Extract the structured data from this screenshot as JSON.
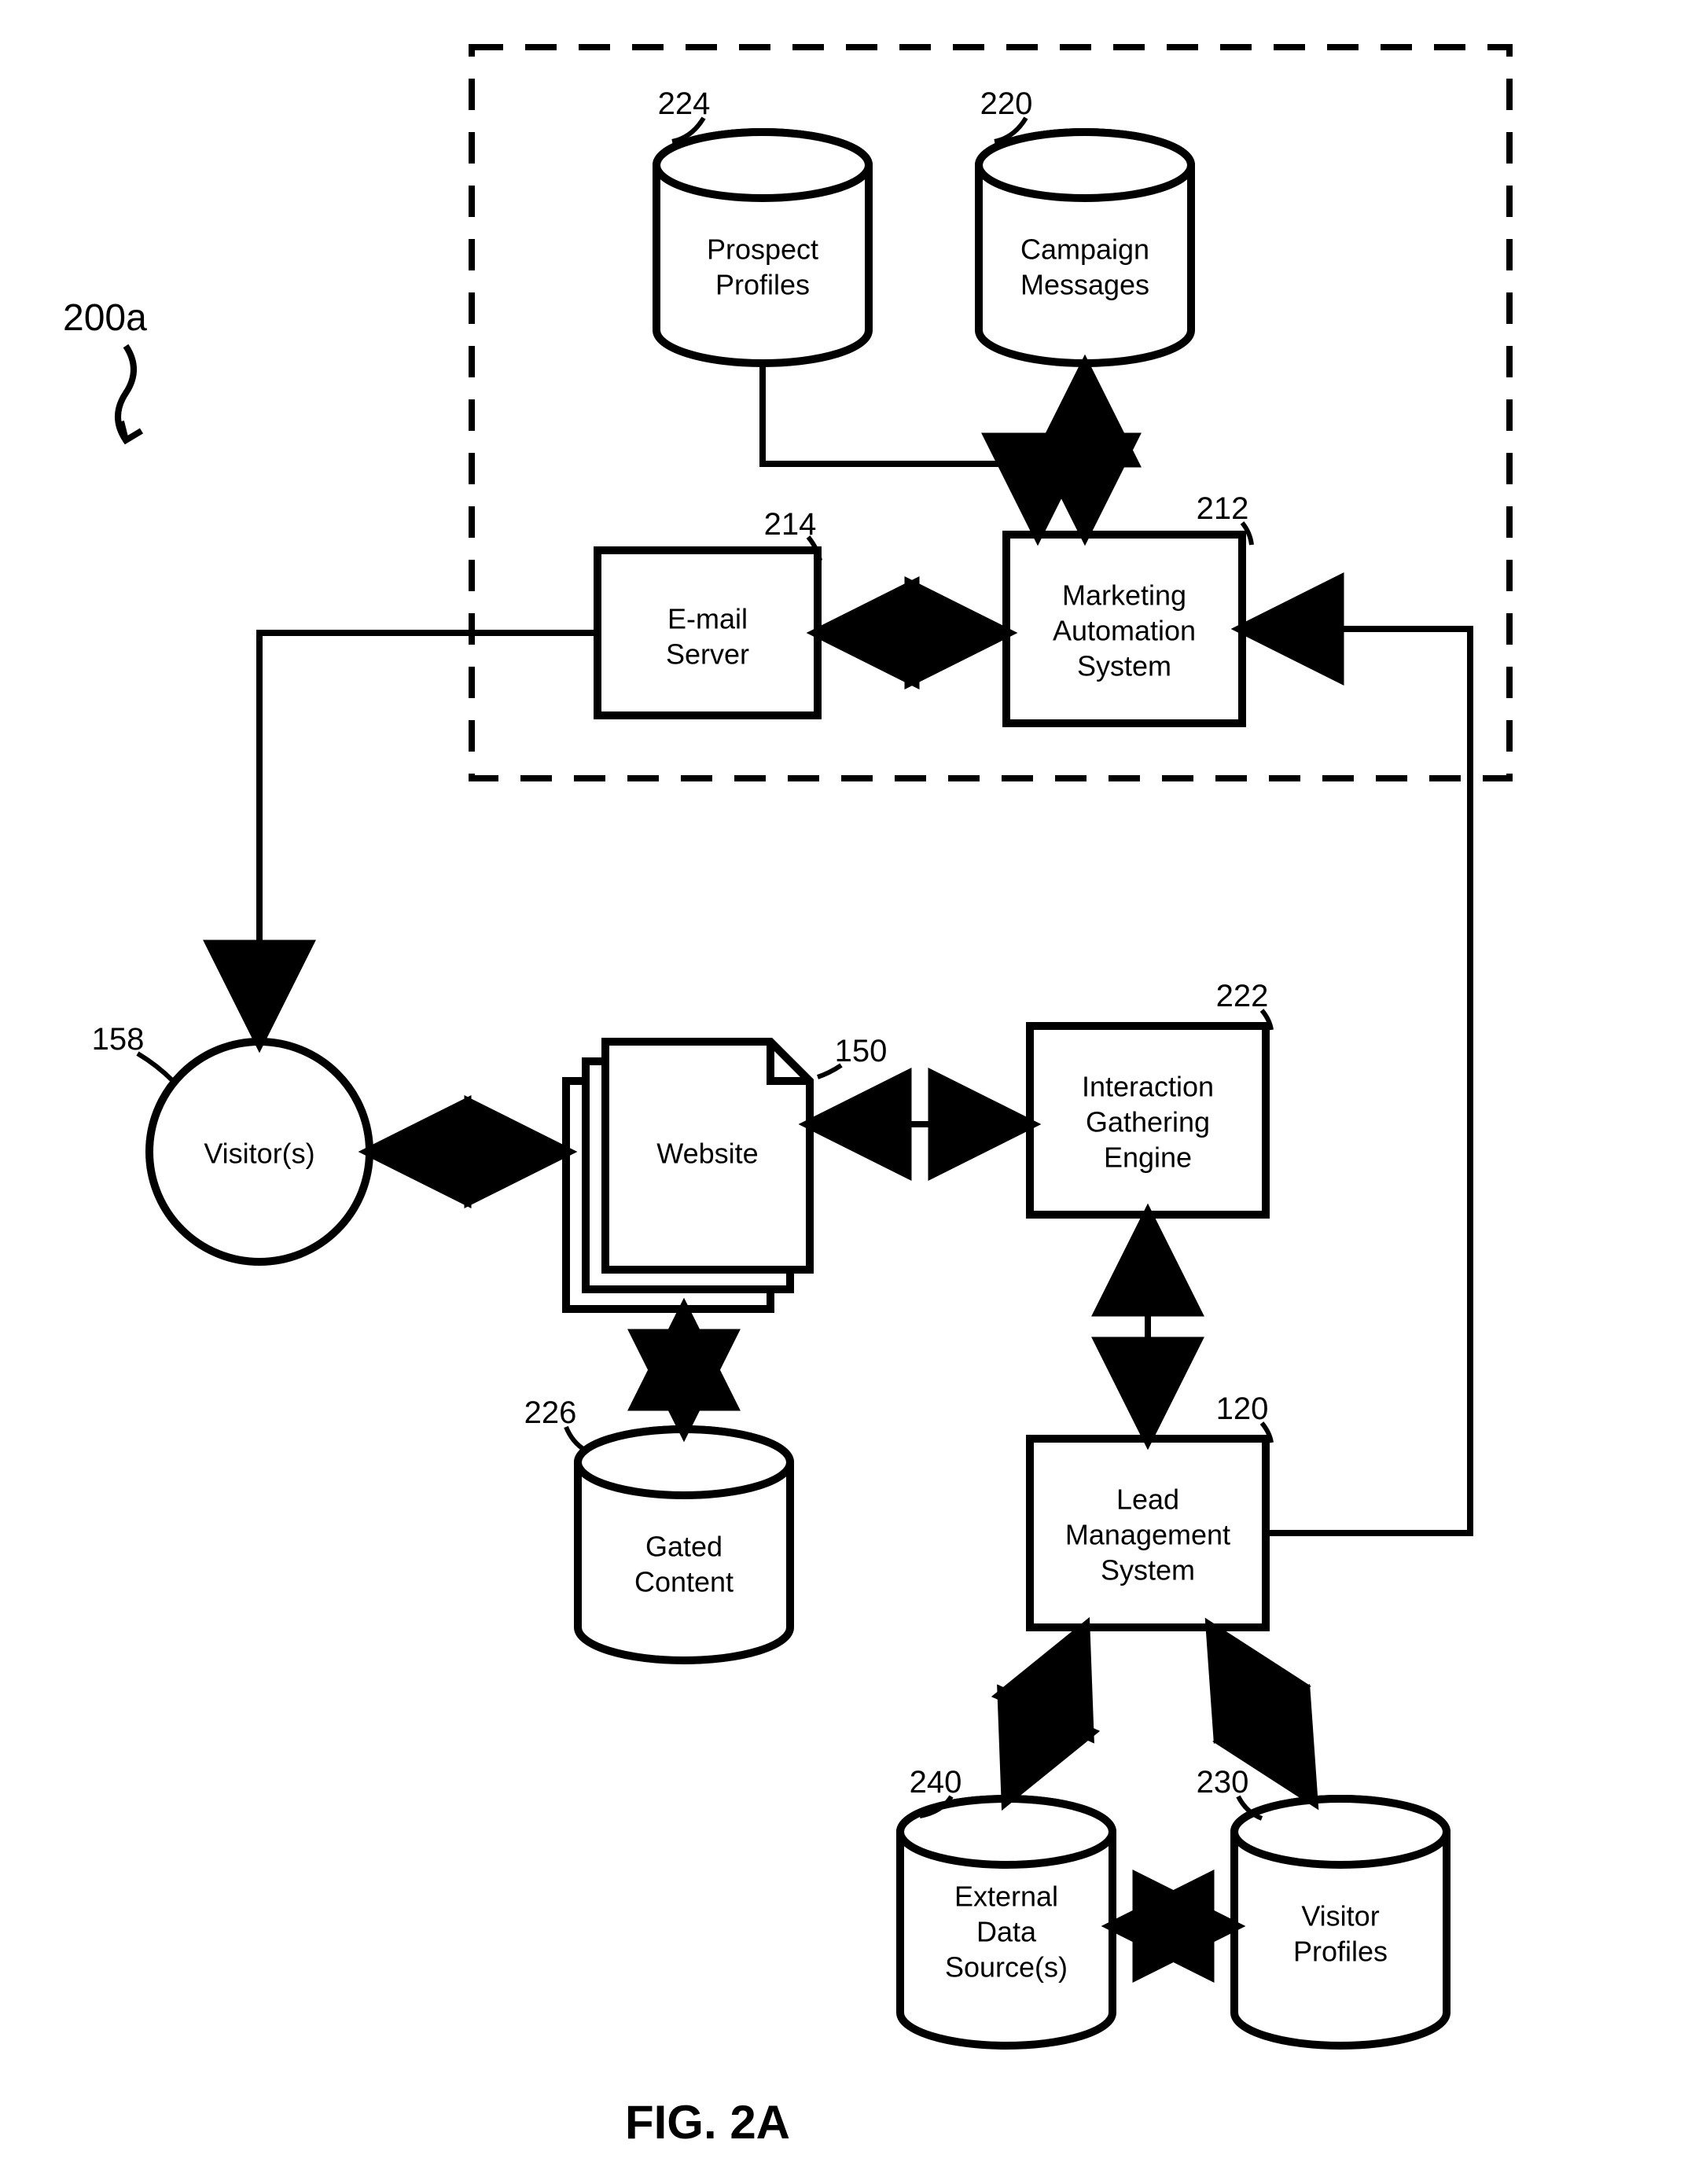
{
  "figure": {
    "caption": "FIG. 2A",
    "system_ref": "200a"
  },
  "nodes": {
    "prospect_profiles": {
      "ref": "224",
      "line1": "Prospect",
      "line2": "Profiles"
    },
    "campaign_messages": {
      "ref": "220",
      "line1": "Campaign",
      "line2": "Messages"
    },
    "email_server": {
      "ref": "214",
      "line1": "E-mail",
      "line2": "Server"
    },
    "marketing_auto": {
      "ref": "212",
      "line1": "Marketing",
      "line2": "Automation",
      "line3": "System"
    },
    "visitors": {
      "ref": "158",
      "line1": "Visitor(s)"
    },
    "website": {
      "ref": "150",
      "line1": "Website"
    },
    "interaction_engine": {
      "ref": "222",
      "line1": "Interaction",
      "line2": "Gathering",
      "line3": "Engine"
    },
    "gated_content": {
      "ref": "226",
      "line1": "Gated",
      "line2": "Content"
    },
    "lead_mgmt": {
      "ref": "120",
      "line1": "Lead",
      "line2": "Management",
      "line3": "System"
    },
    "external_data": {
      "ref": "240",
      "line1": "External",
      "line2": "Data",
      "line3": "Source(s)"
    },
    "visitor_profiles": {
      "ref": "230",
      "line1": "Visitor",
      "line2": "Profiles"
    }
  }
}
